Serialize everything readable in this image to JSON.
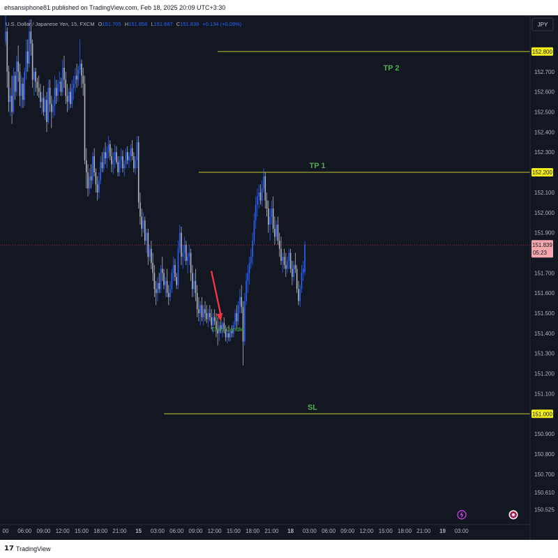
{
  "header": {
    "published_text": "ehsansiphone81 published on TradingView.com, Feb 18, 2025 20:09 UTC+3:30"
  },
  "footer": {
    "logo_text": "TradingView"
  },
  "colors": {
    "background": "#131722",
    "up_candle": "#2962ff",
    "down_candle": "#b2b5be",
    "level_line": "#c8c832",
    "level_tag": "#f5ee19",
    "label_green": "#4caf50",
    "arrow": "#f23645",
    "price_tag": "#f7a8ae",
    "current_line": "#f23645"
  },
  "symbol_legend": {
    "name": "U.S. Dollar / Japanese Yen, 15, FXCM",
    "o_label": "O",
    "o_value": "151.705",
    "h_label": "H",
    "h_value": "151.858",
    "l_label": "L",
    "l_value": "151.687",
    "c_label": "C",
    "c_value": "151.839",
    "change": "+0.134 (+0.09%)"
  },
  "currency_badge": "JPY",
  "current_price": {
    "price": "151.839",
    "countdown": "05:23"
  },
  "icons": {
    "bolt": "lightning-icon",
    "record": "record-icon"
  },
  "chart_data": {
    "type": "candlestick",
    "symbol": "USDJPY",
    "timeframe": "15",
    "ylim": [
      150.45,
      152.98
    ],
    "y_ticks": [
      152.8,
      152.7,
      152.6,
      152.5,
      152.4,
      152.3,
      152.2,
      152.1,
      152.0,
      151.9,
      151.8,
      151.7,
      151.6,
      151.5,
      151.4,
      151.3,
      151.2,
      151.1,
      151.0,
      150.9,
      150.8,
      150.7,
      150.61,
      150.525
    ],
    "y_tick_labels": [
      "152.800",
      "152.700",
      "152.600",
      "152.500",
      "152.400",
      "152.300",
      "152.200",
      "152.100",
      "152.000",
      "151.900",
      "151.800",
      "151.700",
      "151.600",
      "151.500",
      "151.400",
      "151.300",
      "151.200",
      "151.100",
      "151.000",
      "150.900",
      "150.800",
      "150.700",
      "150.610",
      "150.525"
    ],
    "x_tick_labels": [
      {
        "bar": 0,
        "label": "00",
        "bold": false
      },
      {
        "bar": 12,
        "label": "06:00",
        "bold": false
      },
      {
        "bar": 24,
        "label": "09:00",
        "bold": false
      },
      {
        "bar": 36,
        "label": "12:00",
        "bold": false
      },
      {
        "bar": 48,
        "label": "15:00",
        "bold": false
      },
      {
        "bar": 60,
        "label": "18:00",
        "bold": false
      },
      {
        "bar": 72,
        "label": "21:00",
        "bold": false
      },
      {
        "bar": 84,
        "label": "15",
        "bold": true
      },
      {
        "bar": 96,
        "label": "03:00",
        "bold": false
      },
      {
        "bar": 108,
        "label": "06:00",
        "bold": false
      },
      {
        "bar": 120,
        "label": "09:00",
        "bold": false
      },
      {
        "bar": 132,
        "label": "12:00",
        "bold": false
      },
      {
        "bar": 144,
        "label": "15:00",
        "bold": false
      },
      {
        "bar": 156,
        "label": "18:00",
        "bold": false
      },
      {
        "bar": 168,
        "label": "21:00",
        "bold": false
      },
      {
        "bar": 180,
        "label": "18",
        "bold": true
      },
      {
        "bar": 192,
        "label": "03:00",
        "bold": false
      },
      {
        "bar": 204,
        "label": "06:00",
        "bold": false
      },
      {
        "bar": 216,
        "label": "09:00",
        "bold": false
      },
      {
        "bar": 228,
        "label": "12:00",
        "bold": false
      },
      {
        "bar": 240,
        "label": "15:00",
        "bold": false
      },
      {
        "bar": 252,
        "label": "18:00",
        "bold": false
      },
      {
        "bar": 264,
        "label": "21:00",
        "bold": false
      },
      {
        "bar": 276,
        "label": "19",
        "bold": true
      },
      {
        "bar": 288,
        "label": "03:00",
        "bold": false
      }
    ],
    "levels": [
      {
        "name": "TP 2",
        "price": 152.8,
        "price_label": "152.800",
        "start_bar": 134
      },
      {
        "name": "TP 1",
        "price": 152.2,
        "price_label": "152.200",
        "start_bar": 122
      },
      {
        "name": "SL",
        "price": 151.0,
        "price_label": "151.000",
        "start_bar": 100
      }
    ],
    "annotation": {
      "text": "Entry Candle",
      "bar": 138,
      "price": 151.42
    },
    "arrow": {
      "from_bar": 130,
      "from_price": 151.71,
      "to_bar": 136,
      "to_price": 151.46
    },
    "candles": [
      [
        152.85,
        152.98,
        152.83,
        152.9
      ],
      [
        152.9,
        152.92,
        152.62,
        152.7
      ],
      [
        152.7,
        152.73,
        152.5,
        152.55
      ],
      [
        152.55,
        152.62,
        152.48,
        152.58
      ],
      [
        152.58,
        152.68,
        152.44,
        152.5
      ],
      [
        152.5,
        152.72,
        152.49,
        152.68
      ],
      [
        152.68,
        152.7,
        152.56,
        152.6
      ],
      [
        152.6,
        152.78,
        152.58,
        152.75
      ],
      [
        152.75,
        152.83,
        152.65,
        152.7
      ],
      [
        152.7,
        152.74,
        152.53,
        152.58
      ],
      [
        152.58,
        152.68,
        152.52,
        152.64
      ],
      [
        152.64,
        152.67,
        152.52,
        152.56
      ],
      [
        152.56,
        152.72,
        152.53,
        152.7
      ],
      [
        152.7,
        152.86,
        152.66,
        152.8
      ],
      [
        152.8,
        152.86,
        152.7,
        152.74
      ],
      [
        152.74,
        152.96,
        152.72,
        152.9
      ],
      [
        152.9,
        152.96,
        152.78,
        152.84
      ],
      [
        152.84,
        152.86,
        152.62,
        152.66
      ],
      [
        152.66,
        152.72,
        152.58,
        152.7
      ],
      [
        152.7,
        152.72,
        152.6,
        152.65
      ],
      [
        152.65,
        152.67,
        152.58,
        152.62
      ],
      [
        152.62,
        152.68,
        152.57,
        152.6
      ],
      [
        152.6,
        152.64,
        152.52,
        152.55
      ],
      [
        152.55,
        152.6,
        152.49,
        152.57
      ],
      [
        152.57,
        152.63,
        152.48,
        152.5
      ],
      [
        152.5,
        152.58,
        152.46,
        152.56
      ],
      [
        152.56,
        152.6,
        152.4,
        152.45
      ],
      [
        152.45,
        152.66,
        152.44,
        152.62
      ],
      [
        152.62,
        152.66,
        152.5,
        152.54
      ],
      [
        152.54,
        152.58,
        152.42,
        152.5
      ],
      [
        152.5,
        152.56,
        152.47,
        152.53
      ],
      [
        152.53,
        152.68,
        152.48,
        152.62
      ],
      [
        152.62,
        152.66,
        152.54,
        152.58
      ],
      [
        152.58,
        152.66,
        152.55,
        152.64
      ],
      [
        152.64,
        152.7,
        152.6,
        152.65
      ],
      [
        152.65,
        152.67,
        152.58,
        152.6
      ],
      [
        152.6,
        152.76,
        152.58,
        152.72
      ],
      [
        152.72,
        152.78,
        152.62,
        152.66
      ],
      [
        152.66,
        152.7,
        152.54,
        152.58
      ],
      [
        152.58,
        152.64,
        152.5,
        152.55
      ],
      [
        152.55,
        152.62,
        152.51,
        152.6
      ],
      [
        152.6,
        152.64,
        152.52,
        152.54
      ],
      [
        152.54,
        152.66,
        152.52,
        152.62
      ],
      [
        152.62,
        152.68,
        152.56,
        152.64
      ],
      [
        152.64,
        152.72,
        152.6,
        152.68
      ],
      [
        152.68,
        152.74,
        152.62,
        152.66
      ],
      [
        152.66,
        152.73,
        152.63,
        152.71
      ],
      [
        152.71,
        152.86,
        152.69,
        152.74
      ],
      [
        152.74,
        152.76,
        152.62,
        152.68
      ],
      [
        152.68,
        152.72,
        152.58,
        152.64
      ],
      [
        152.64,
        152.68,
        152.24,
        152.26
      ],
      [
        152.26,
        152.32,
        152.12,
        152.2
      ],
      [
        152.2,
        152.24,
        152.08,
        152.12
      ],
      [
        152.12,
        152.22,
        152.09,
        152.18
      ],
      [
        152.18,
        152.24,
        152.12,
        152.16
      ],
      [
        152.16,
        152.3,
        152.14,
        152.28
      ],
      [
        152.28,
        152.32,
        152.18,
        152.2
      ],
      [
        152.2,
        152.22,
        152.1,
        152.14
      ],
      [
        152.14,
        152.18,
        152.06,
        152.1
      ],
      [
        152.1,
        152.2,
        152.07,
        152.16
      ],
      [
        152.16,
        152.28,
        152.14,
        152.25
      ],
      [
        152.25,
        152.3,
        152.2,
        152.22
      ],
      [
        152.22,
        152.32,
        152.2,
        152.3
      ],
      [
        152.3,
        152.35,
        152.24,
        152.27
      ],
      [
        152.27,
        152.33,
        152.22,
        152.3
      ],
      [
        152.3,
        152.38,
        152.27,
        152.34
      ],
      [
        152.34,
        152.36,
        152.26,
        152.28
      ],
      [
        152.28,
        152.32,
        152.2,
        152.24
      ],
      [
        152.24,
        152.3,
        152.19,
        152.26
      ],
      [
        152.26,
        152.34,
        152.22,
        152.3
      ],
      [
        152.3,
        152.33,
        152.24,
        152.25
      ],
      [
        152.25,
        152.28,
        152.18,
        152.2
      ],
      [
        152.2,
        152.28,
        152.18,
        152.26
      ],
      [
        152.26,
        152.32,
        152.22,
        152.28
      ],
      [
        152.28,
        152.31,
        152.2,
        152.22
      ],
      [
        152.22,
        152.26,
        152.18,
        152.24
      ],
      [
        152.24,
        152.32,
        152.22,
        152.3
      ],
      [
        152.3,
        152.33,
        152.24,
        152.26
      ],
      [
        152.26,
        152.3,
        152.22,
        152.28
      ],
      [
        152.28,
        152.34,
        152.25,
        152.32
      ],
      [
        152.32,
        152.36,
        152.26,
        152.28
      ],
      [
        152.28,
        152.3,
        152.2,
        152.22
      ],
      [
        152.22,
        152.28,
        152.19,
        152.26
      ],
      [
        152.26,
        152.38,
        152.22,
        152.35
      ],
      [
        152.35,
        152.38,
        152.02,
        152.05
      ],
      [
        152.05,
        152.1,
        151.94,
        151.98
      ],
      [
        151.98,
        152.02,
        151.88,
        151.92
      ],
      [
        151.92,
        152.0,
        151.9,
        151.96
      ],
      [
        151.96,
        151.98,
        151.84,
        151.86
      ],
      [
        151.86,
        151.92,
        151.8,
        151.9
      ],
      [
        151.9,
        151.92,
        151.74,
        151.78
      ],
      [
        151.78,
        151.84,
        151.76,
        151.82
      ],
      [
        151.82,
        151.86,
        151.72,
        151.75
      ],
      [
        151.75,
        151.8,
        151.66,
        151.7
      ],
      [
        151.7,
        151.74,
        151.58,
        151.62
      ],
      [
        151.62,
        151.66,
        151.54,
        151.6
      ],
      [
        151.6,
        151.68,
        151.56,
        151.65
      ],
      [
        151.65,
        151.7,
        151.6,
        151.62
      ],
      [
        151.62,
        151.74,
        151.6,
        151.72
      ],
      [
        151.72,
        151.78,
        151.66,
        151.7
      ],
      [
        151.7,
        151.72,
        151.62,
        151.64
      ],
      [
        151.64,
        151.68,
        151.58,
        151.66
      ],
      [
        151.66,
        151.72,
        151.58,
        151.6
      ],
      [
        151.6,
        151.64,
        151.54,
        151.58
      ],
      [
        151.58,
        151.66,
        151.56,
        151.62
      ],
      [
        151.62,
        151.72,
        151.6,
        151.7
      ],
      [
        151.7,
        151.78,
        151.66,
        151.74
      ],
      [
        151.74,
        151.77,
        151.66,
        151.68
      ],
      [
        151.68,
        151.7,
        151.62,
        151.64
      ],
      [
        151.64,
        151.86,
        151.62,
        151.82
      ],
      [
        151.82,
        151.94,
        151.8,
        151.9
      ],
      [
        151.9,
        151.93,
        151.74,
        151.78
      ],
      [
        151.78,
        151.84,
        151.72,
        151.8
      ],
      [
        151.8,
        151.88,
        151.76,
        151.84
      ],
      [
        151.84,
        151.86,
        151.74,
        151.76
      ],
      [
        151.76,
        151.8,
        151.7,
        151.78
      ],
      [
        151.78,
        151.84,
        151.74,
        151.8
      ],
      [
        151.8,
        151.82,
        151.66,
        151.7
      ],
      [
        151.7,
        151.74,
        151.58,
        151.62
      ],
      [
        151.62,
        151.7,
        151.58,
        151.66
      ],
      [
        151.66,
        151.72,
        151.56,
        151.6
      ],
      [
        151.6,
        151.64,
        151.48,
        151.52
      ],
      [
        151.52,
        151.58,
        151.46,
        151.5
      ],
      [
        151.5,
        151.56,
        151.44,
        151.54
      ],
      [
        151.54,
        151.58,
        151.46,
        151.48
      ],
      [
        151.48,
        151.54,
        151.44,
        151.52
      ],
      [
        151.52,
        151.56,
        151.46,
        151.5
      ],
      [
        151.5,
        151.54,
        151.45,
        151.47
      ],
      [
        151.47,
        151.52,
        151.43,
        151.5
      ],
      [
        151.5,
        151.54,
        151.46,
        151.48
      ],
      [
        151.48,
        151.52,
        151.42,
        151.44
      ],
      [
        151.44,
        151.5,
        151.4,
        151.48
      ],
      [
        151.48,
        151.52,
        151.44,
        151.46
      ],
      [
        151.46,
        151.5,
        151.38,
        151.42
      ],
      [
        151.42,
        151.48,
        151.34,
        151.4
      ],
      [
        151.4,
        151.46,
        151.36,
        151.44
      ],
      [
        151.44,
        151.48,
        151.4,
        151.42
      ],
      [
        151.42,
        151.46,
        151.38,
        151.45
      ],
      [
        151.45,
        151.48,
        151.4,
        151.42
      ],
      [
        151.42,
        151.44,
        151.36,
        151.38
      ],
      [
        151.38,
        151.42,
        151.35,
        151.4
      ],
      [
        151.4,
        151.44,
        151.36,
        151.38
      ],
      [
        151.38,
        151.42,
        151.36,
        151.41
      ],
      [
        151.41,
        151.44,
        151.38,
        151.4
      ],
      [
        151.4,
        151.46,
        151.38,
        151.44
      ],
      [
        151.44,
        151.52,
        151.42,
        151.5
      ],
      [
        151.5,
        151.54,
        151.42,
        151.46
      ],
      [
        151.46,
        151.56,
        151.44,
        151.54
      ],
      [
        151.54,
        151.62,
        151.5,
        151.58
      ],
      [
        151.58,
        151.64,
        151.5,
        151.53
      ],
      [
        151.53,
        151.56,
        151.24,
        151.36
      ],
      [
        151.36,
        151.6,
        151.34,
        151.56
      ],
      [
        151.56,
        151.7,
        151.54,
        151.66
      ],
      [
        151.66,
        151.74,
        151.6,
        151.7
      ],
      [
        151.7,
        151.78,
        151.64,
        151.75
      ],
      [
        151.75,
        151.82,
        151.72,
        151.78
      ],
      [
        151.78,
        151.9,
        151.74,
        151.86
      ],
      [
        151.86,
        152.0,
        151.84,
        151.96
      ],
      [
        151.96,
        152.08,
        151.92,
        152.04
      ],
      [
        152.04,
        152.12,
        151.98,
        152.08
      ],
      [
        152.08,
        152.14,
        152.02,
        152.1
      ],
      [
        152.1,
        152.14,
        152.04,
        152.06
      ],
      [
        152.06,
        152.16,
        152.03,
        152.12
      ],
      [
        152.12,
        152.22,
        152.1,
        152.18
      ],
      [
        152.18,
        152.2,
        152.02,
        152.06
      ],
      [
        152.06,
        152.1,
        151.98,
        152.02
      ],
      [
        152.02,
        152.06,
        151.9,
        151.94
      ],
      [
        151.94,
        152.02,
        151.86,
        151.98
      ],
      [
        151.98,
        152.06,
        151.94,
        152.02
      ],
      [
        152.02,
        152.08,
        151.9,
        151.92
      ],
      [
        151.92,
        151.98,
        151.84,
        151.88
      ],
      [
        151.88,
        151.96,
        151.86,
        151.94
      ],
      [
        151.94,
        151.98,
        151.84,
        151.86
      ],
      [
        151.86,
        151.9,
        151.78,
        151.82
      ],
      [
        151.82,
        151.88,
        151.74,
        151.76
      ],
      [
        151.76,
        151.8,
        151.7,
        151.78
      ],
      [
        151.78,
        151.82,
        151.72,
        151.74
      ],
      [
        151.74,
        151.8,
        151.68,
        151.72
      ],
      [
        151.72,
        151.78,
        151.7,
        151.76
      ],
      [
        151.76,
        151.82,
        151.72,
        151.8
      ],
      [
        151.8,
        151.82,
        151.7,
        151.72
      ],
      [
        151.72,
        151.76,
        151.64,
        151.68
      ],
      [
        151.68,
        151.76,
        151.66,
        151.74
      ],
      [
        151.74,
        151.8,
        151.7,
        151.72
      ],
      [
        151.72,
        151.74,
        151.6,
        151.62
      ],
      [
        151.62,
        151.66,
        151.54,
        151.56
      ],
      [
        151.56,
        151.64,
        151.53,
        151.62
      ],
      [
        151.62,
        151.74,
        151.6,
        151.7
      ],
      [
        151.7,
        151.76,
        151.66,
        151.72
      ],
      [
        151.705,
        151.858,
        151.687,
        151.839
      ]
    ]
  }
}
